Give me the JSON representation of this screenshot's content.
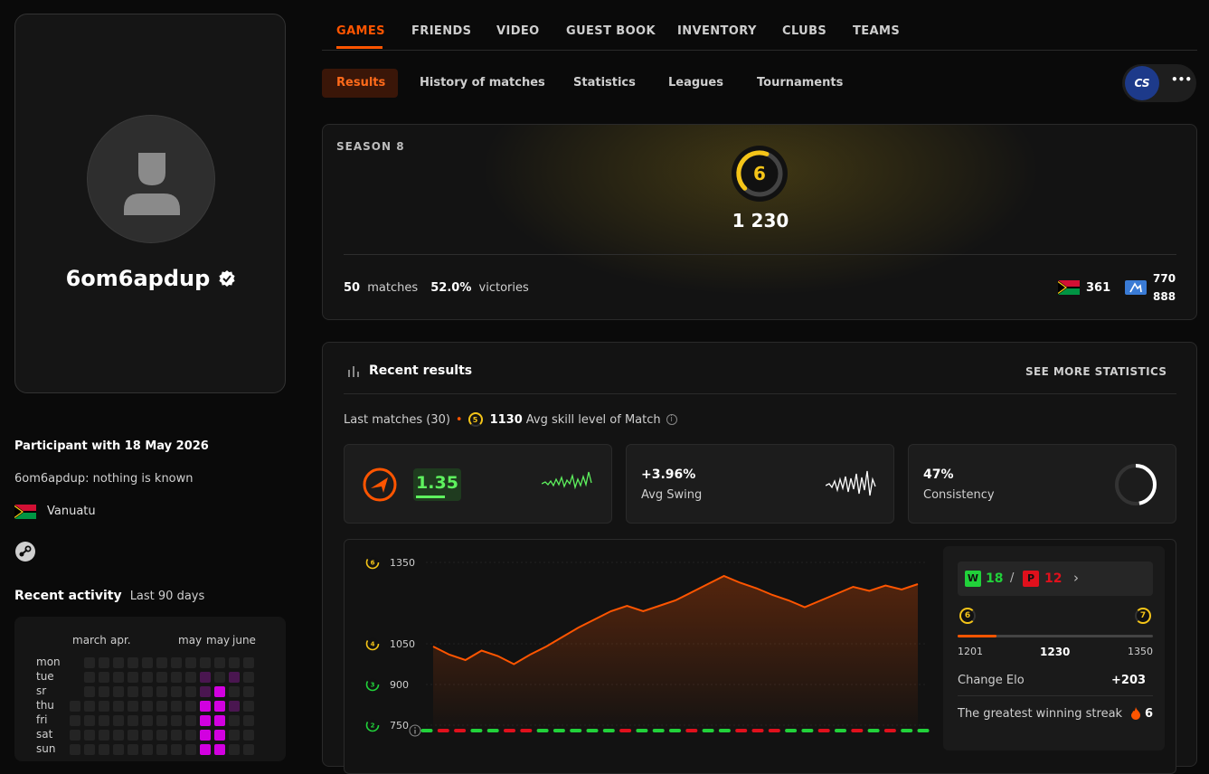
{
  "profile": {
    "username": "6om6apdup",
    "participant": "Participant with 18 May 2026",
    "bio": "6om6apdup: nothing is known",
    "country": "Vanuatu",
    "recent_activity_title": "Recent activity",
    "recent_activity_period": "Last 90 days"
  },
  "activity": {
    "months": [
      "march",
      "apr.",
      "may",
      "may",
      "june"
    ],
    "days": [
      "mon",
      "tue",
      "sr",
      "thu",
      "fri",
      "sat",
      "sun"
    ]
  },
  "nav": {
    "tabs": [
      "GAMES",
      "FRIENDS",
      "VIDEO",
      "GUEST BOOK",
      "INVENTORY",
      "CLUBS",
      "TEAMS"
    ]
  },
  "subnav": {
    "tabs": [
      "Results",
      "History of matches",
      "Statistics",
      "Leagues",
      "Tournaments"
    ],
    "game_badge": "CS",
    "more": "•••"
  },
  "season": {
    "title": "SEASON 8",
    "level": "6",
    "elo": "1 230",
    "matches_count": "50",
    "matches_label": "matches",
    "victories_pct": "52.0%",
    "victories_label": "victories",
    "country_rank": "361",
    "region_rank_line1": "770",
    "region_rank_line2": "888"
  },
  "recent": {
    "title": "Recent results",
    "see_more": "SEE MORE STATISTICS",
    "last_matches": "Last matches (30)",
    "avg_level_icon": "5",
    "avg_skill_value": "1130",
    "avg_skill_label": "Avg skill level of Match"
  },
  "stats": {
    "rating": "1.35",
    "swing_value": "+3.96%",
    "swing_label": "Avg Swing",
    "consistency_value": "47%",
    "consistency_label": "Consistency",
    "consistency_fraction": 0.47
  },
  "chart_data": {
    "type": "area",
    "y_ticks": [
      1350,
      1050,
      900,
      750
    ],
    "y_tick_levels": [
      "6",
      "4",
      "3",
      "2"
    ],
    "ylim": [
      700,
      1400
    ],
    "values": [
      1040,
      1010,
      990,
      1025,
      1005,
      975,
      1010,
      1040,
      1075,
      1110,
      1140,
      1170,
      1190,
      1170,
      1190,
      1210,
      1240,
      1270,
      1300,
      1275,
      1255,
      1230,
      1210,
      1185,
      1210,
      1235,
      1260,
      1245,
      1265,
      1250,
      1270
    ],
    "results": [
      "W",
      "L",
      "L",
      "W",
      "W",
      "L",
      "L",
      "W",
      "W",
      "W",
      "W",
      "W",
      "L",
      "W",
      "W",
      "W",
      "L",
      "W",
      "W",
      "L",
      "L",
      "L",
      "W",
      "W",
      "L",
      "W",
      "L",
      "W",
      "L",
      "W",
      "W"
    ]
  },
  "summary": {
    "wins_label": "W",
    "wins": "18",
    "separator": "/",
    "losses_label": "P",
    "losses": "12",
    "level_from": "6",
    "level_to": "7",
    "range_min": "1201",
    "range_current": "1230",
    "range_max": "1350",
    "progress_fraction": 0.2,
    "change_elo_label": "Change Elo",
    "change_elo": "+203",
    "streak_label": "The greatest winning streak",
    "streak": "6"
  },
  "colors": {
    "accent": "#ff5500",
    "win": "#21d13a",
    "loss": "#e0101c",
    "gold": "#f5c518",
    "magenta": "#d200e0"
  }
}
